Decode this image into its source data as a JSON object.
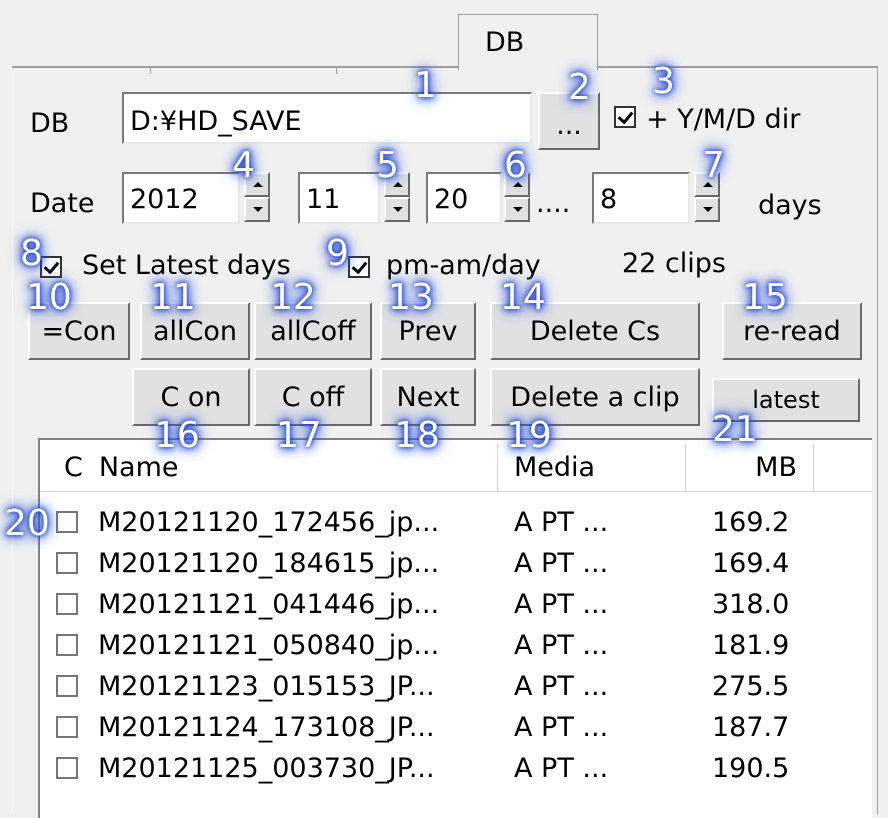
{
  "tabs": {
    "active": "DB"
  },
  "db": {
    "label": "DB",
    "path": "D:¥HD_SAVE",
    "browse_label": "...",
    "ymd_label": "+ Y/M/D dir",
    "ymd_checked": true
  },
  "date": {
    "label": "Date",
    "year": "2012",
    "month": "11",
    "day": "20",
    "range_sep": "....",
    "days": "8",
    "days_label": "days"
  },
  "options": {
    "set_latest_label": "Set Latest days",
    "pm_am_label": "pm-am/day",
    "clips_count": "22 clips"
  },
  "buttons": {
    "eq_con": "=Con",
    "all_con": "allCon",
    "all_coff": "allCoff",
    "prev": "Prev",
    "delete_cs": "Delete Cs",
    "reread": "re-read",
    "c_on": "C on",
    "c_off": "C off",
    "next": "Next",
    "delete_clip": "Delete a clip",
    "latest": "latest"
  },
  "table": {
    "columns": {
      "c": "C",
      "name": "Name",
      "media": "Media",
      "mb": "MB"
    },
    "rows": [
      {
        "name": "M20121120_172456_jp...",
        "media": "A  PT  ...",
        "mb": "169.2"
      },
      {
        "name": "M20121120_184615_jp...",
        "media": "A  PT  ...",
        "mb": "169.4"
      },
      {
        "name": "M20121121_041446_jp...",
        "media": "A  PT  ...",
        "mb": "318.0"
      },
      {
        "name": "M20121121_050840_jp...",
        "media": "A  PT  ...",
        "mb": "181.9"
      },
      {
        "name": "M20121123_015153_JP...",
        "media": "A  PT  ...",
        "mb": "275.5"
      },
      {
        "name": "M20121124_173108_JP...",
        "media": "A  PT  ...",
        "mb": "187.7"
      },
      {
        "name": "M20121125_003730_JP...",
        "media": "A  PT  ...",
        "mb": "190.5"
      }
    ]
  },
  "callouts": [
    "1",
    "2",
    "3",
    "4",
    "5",
    "6",
    "7",
    "8",
    "9",
    "10",
    "11",
    "12",
    "13",
    "14",
    "15",
    "16",
    "17",
    "18",
    "19",
    "20",
    "21"
  ],
  "colors": {
    "callout_glow": "#1f3fc4",
    "panel": "#f0f0f0"
  }
}
